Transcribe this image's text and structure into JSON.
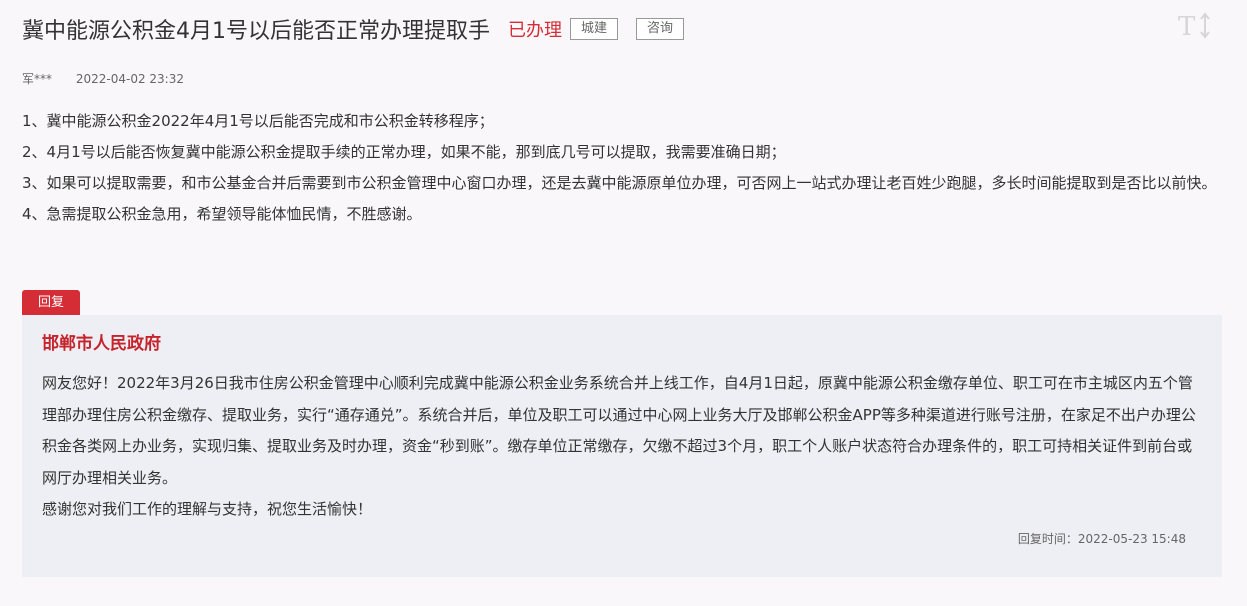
{
  "header": {
    "title": "冀中能源公积金4月1号以后能否正常办理提取手",
    "status": "已办理",
    "tags": [
      "城建",
      "咨询"
    ],
    "font_toggle_label": "T↕"
  },
  "meta": {
    "author": "军***",
    "time": "2022-04-02 23:32"
  },
  "question": {
    "lines": [
      "1、冀中能源公积金2022年4月1号以后能否完成和市公积金转移程序；",
      "2、4月1号以后能否恢复冀中能源公积金提取手续的正常办理，如果不能，那到底几号可以提取，我需要准确日期；",
      "3、如果可以提取需要，和市公基金合并后需要到市公积金管理中心窗口办理，还是去冀中能源原单位办理，可否网上一站式办理让老百姓少跑腿，多长时间能提取到是否比以前快。",
      "4、急需提取公积金急用，希望领导能体恤民情，不胜感谢。"
    ]
  },
  "reply": {
    "tab_label": "回复",
    "replier": "邯郸市人民政府",
    "paragraphs": [
      "网友您好！2022年3月26日我市住房公积金管理中心顺利完成冀中能源公积金业务系统合并上线工作，自4月1日起，原冀中能源公积金缴存单位、职工可在市主城区内五个管理部办理住房公积金缴存、提取业务，实行“通存通兑”。系统合并后，单位及职工可以通过中心网上业务大厅及邯郸公积金APP等多种渠道进行账号注册，在家足不出户办理公积金各类网上办业务，实现归集、提取业务及时办理，资金“秒到账”。缴存单位正常缴存，欠缴不超过3个月，职工个人账户状态符合办理条件的，职工可持相关证件到前台或网厅办理相关业务。",
      "感谢您对我们工作的理解与支持，祝您生活愉快！"
    ],
    "time_label": "回复时间：2022-05-23 15:48"
  },
  "colors": {
    "accent": "#d42d36",
    "replier": "#c5242d",
    "background": "#f9f7fa",
    "reply_background": "#eeeff4"
  }
}
